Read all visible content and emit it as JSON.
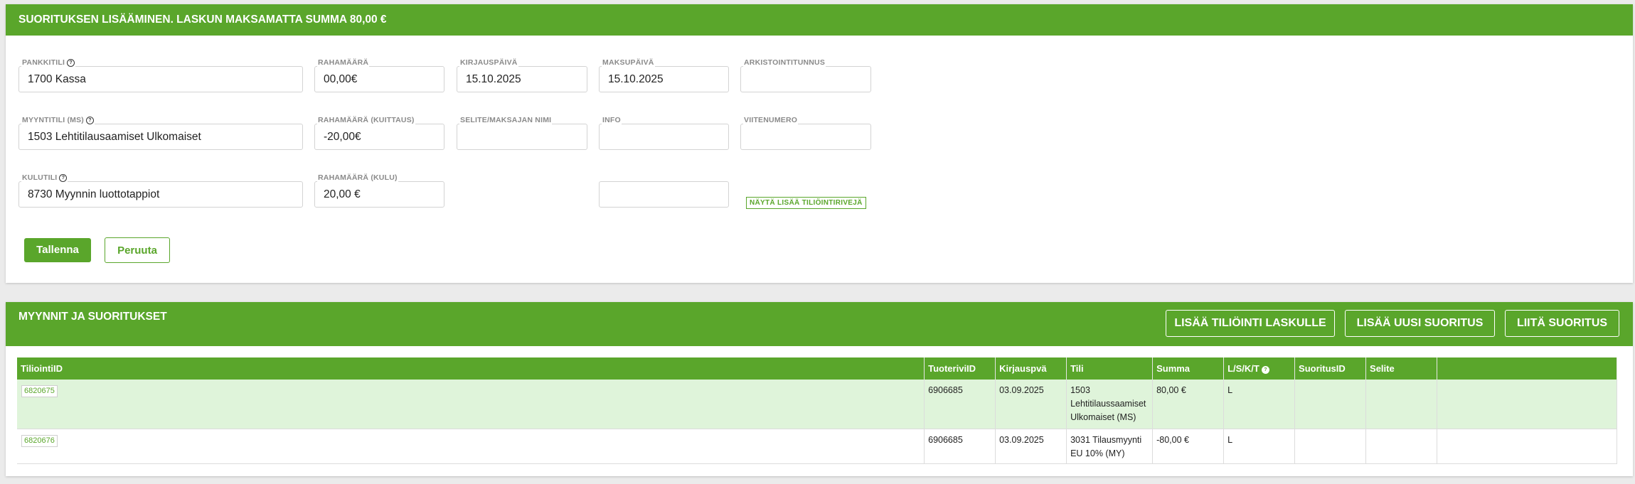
{
  "form": {
    "title": "SUORITUKSEN LISÄÄMINEN. LASKUN MAKSAMATTA SUMMA 80,00 €",
    "row1": {
      "pankkitili": {
        "label": "PANKKITILI",
        "value": "1700 Kassa"
      },
      "rahamaara": {
        "label": "RAHAMÄÄRÄ",
        "value": "00,00€"
      },
      "kirjauspaiva": {
        "label": "KIRJAUSPÄIVÄ",
        "value": "15.10.2025"
      },
      "maksupaiva": {
        "label": "MAKSUPÄIVÄ",
        "value": "15.10.2025"
      },
      "arkistointitunnus": {
        "label": "ARKISTOINTITUNNUS",
        "value": ""
      }
    },
    "row2": {
      "myyntitili": {
        "label": "MYYNTITILI (MS)",
        "value": "1503 Lehtitilausaamiset Ulkomaiset"
      },
      "rahamaara_kuittaus": {
        "label": "RAHAMÄÄRÄ (KUITTAUS)",
        "value": "-20,00€"
      },
      "selite": {
        "label": "SELITE/MAKSAJAN NIMI",
        "value": ""
      },
      "info": {
        "label": "INFO",
        "value": ""
      },
      "viitenumero": {
        "label": "VIITENUMERO",
        "value": ""
      }
    },
    "row3": {
      "kulutili": {
        "label": "KULUTILI",
        "value": "8730 Myynnin luottotappiot"
      },
      "rahamaara_kulu": {
        "label": "RAHAMÄÄRÄ (KULU)",
        "value": "20,00 €"
      },
      "extra": {
        "value": ""
      }
    },
    "show_more_label": "NÄYTÄ LISÄÄ TILIÖINTIRIVEJÄ",
    "save_label": "Tallenna",
    "cancel_label": "Peruuta",
    "help_glyph": "?"
  },
  "sales": {
    "title": "MYYNNIT JA SUORITUKSET",
    "buttons": {
      "add_posting": "LISÄÄ TILIÖINTI LASKULLE",
      "add_payment": "LISÄÄ UUSI SUORITUS",
      "attach_payment": "LIITÄ SUORITUS"
    },
    "columns": [
      "TiliointiID",
      "TuoteriviID",
      "Kirjauspvä",
      "Tili",
      "Summa",
      "L/S/K/T",
      "SuoritusID",
      "Selite",
      ""
    ],
    "rows": [
      {
        "tiliointi_id": "6820675",
        "tuoterivi_id": "6906685",
        "kirjauspva": "03.09.2025",
        "tili": "1503 Lehtitilaussaamiset Ulkomaiset (MS)",
        "summa": "80,00 €",
        "lskt": "L",
        "suoritus_id": "",
        "selite": "",
        "extra": ""
      },
      {
        "tiliointi_id": "6820676",
        "tuoterivi_id": "6906685",
        "kirjauspva": "03.09.2025",
        "tili": "3031 Tilausmyynti EU 10% (MY)",
        "summa": "-80,00 €",
        "lskt": "L",
        "suoritus_id": "",
        "selite": "",
        "extra": ""
      }
    ]
  },
  "colors": {
    "accent": "#5aa62b",
    "highlight_row": "#dff4da"
  },
  "icons": {
    "help": "question-circle-icon"
  }
}
